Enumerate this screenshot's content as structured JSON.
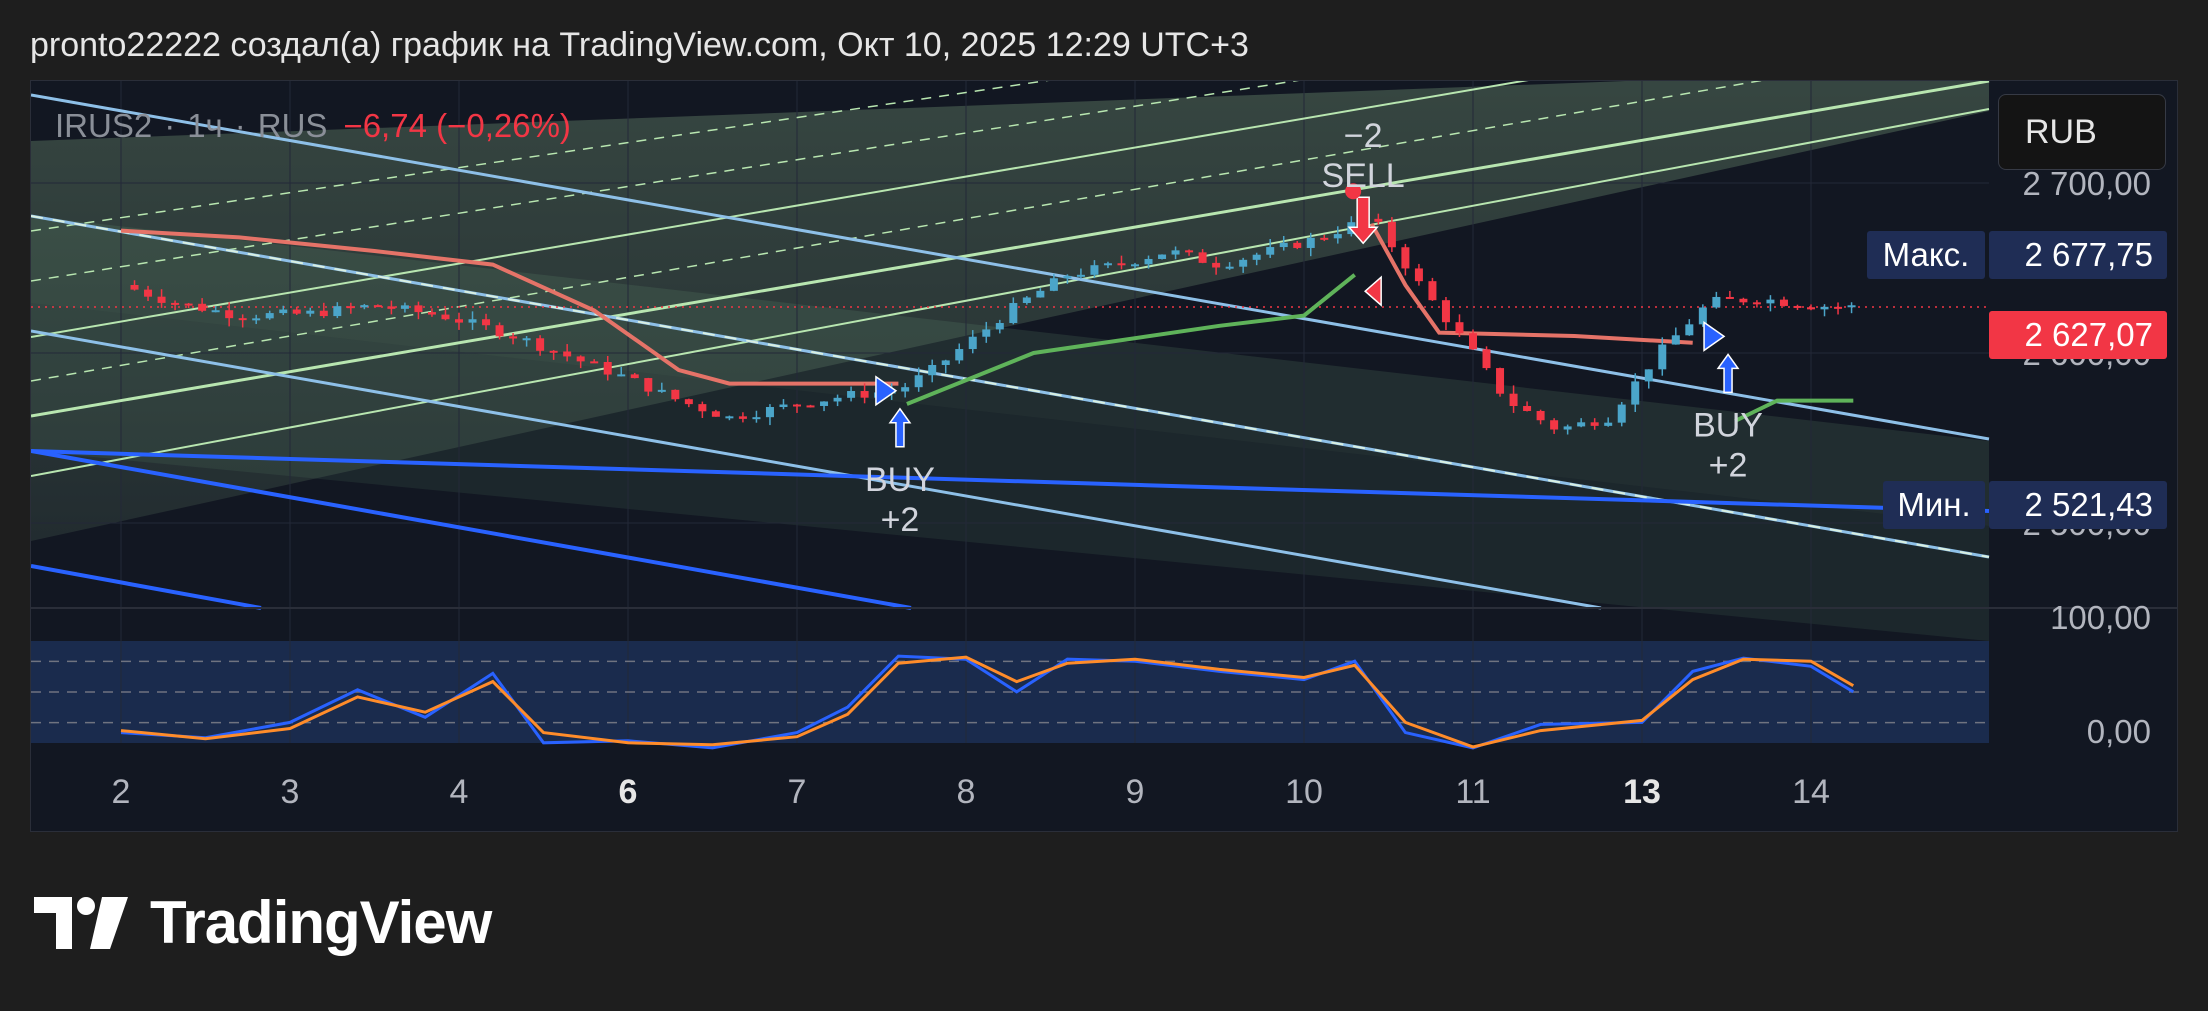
{
  "header": {
    "title": "pronto22222 создал(а) график на TradingView.com, Окт 10, 2025 12:29 UTC+3"
  },
  "chart": {
    "symbol": "IRUS2",
    "interval": "1ч",
    "exchange": "RUS",
    "change": "−6,74 (−0,26%)",
    "currency": "RUB",
    "max_label": "Макс.",
    "max_value": "2 677,75",
    "min_label": "Мин.",
    "min_value": "2 521,43",
    "last_price": "2 627,07"
  },
  "colors": {
    "background": "#121722",
    "bear": "#f23645",
    "bull": "#4ba5c9",
    "supertrend_bear": "#e57368",
    "supertrend_bull": "#5fb35a",
    "channel_line": "#8ec0e8",
    "trend_line": "#2962ff",
    "fib_green": "#b8e6b0",
    "stoch_k": "#2962ff",
    "stoch_d": "#ff8c2a",
    "max_tag": "#1f2d55",
    "last_tag": "#f23645"
  },
  "footer": {
    "brand": "TradingView"
  },
  "chart_data": {
    "type": "candlestick",
    "currency": "RUB",
    "ylim": [
      2450,
      2760
    ],
    "x_ticks": [
      {
        "label": "2",
        "bold": false
      },
      {
        "label": "3",
        "bold": false
      },
      {
        "label": "4",
        "bold": false
      },
      {
        "label": "6",
        "bold": true
      },
      {
        "label": "7",
        "bold": false
      },
      {
        "label": "8",
        "bold": false
      },
      {
        "label": "9",
        "bold": false
      },
      {
        "label": "10",
        "bold": false
      },
      {
        "label": "11",
        "bold": false
      },
      {
        "label": "13",
        "bold": true
      },
      {
        "label": "14",
        "bold": false
      }
    ],
    "y_ticks": [
      "2 700,00",
      "2 600,00",
      "2 500,00"
    ],
    "close_series": [
      {
        "t": 0.0,
        "v": 2640
      },
      {
        "t": 0.3,
        "v": 2630
      },
      {
        "t": 0.7,
        "v": 2622
      },
      {
        "t": 1.1,
        "v": 2623
      },
      {
        "t": 1.5,
        "v": 2628
      },
      {
        "t": 1.9,
        "v": 2622
      },
      {
        "t": 2.3,
        "v": 2611
      },
      {
        "t": 2.7,
        "v": 2596
      },
      {
        "t": 3.0,
        "v": 2585
      },
      {
        "t": 3.3,
        "v": 2572
      },
      {
        "t": 3.6,
        "v": 2562
      },
      {
        "t": 4.0,
        "v": 2570
      },
      {
        "t": 4.3,
        "v": 2575
      },
      {
        "t": 4.6,
        "v": 2578
      },
      {
        "t": 4.8,
        "v": 2590
      },
      {
        "t": 5.0,
        "v": 2605
      },
      {
        "t": 5.3,
        "v": 2628
      },
      {
        "t": 5.6,
        "v": 2646
      },
      {
        "t": 5.9,
        "v": 2652
      },
      {
        "t": 6.2,
        "v": 2660
      },
      {
        "t": 6.5,
        "v": 2652
      },
      {
        "t": 6.8,
        "v": 2660
      },
      {
        "t": 7.1,
        "v": 2668
      },
      {
        "t": 7.4,
        "v": 2680
      },
      {
        "t": 7.7,
        "v": 2638
      },
      {
        "t": 8.0,
        "v": 2600
      },
      {
        "t": 8.2,
        "v": 2572
      },
      {
        "t": 8.5,
        "v": 2555
      },
      {
        "t": 8.8,
        "v": 2562
      },
      {
        "t": 9.1,
        "v": 2600
      },
      {
        "t": 9.4,
        "v": 2630
      },
      {
        "t": 9.7,
        "v": 2632
      },
      {
        "t": 10.0,
        "v": 2628
      },
      {
        "t": 10.25,
        "v": 2627
      }
    ],
    "markers": [
      {
        "type": "BUY",
        "qty": "+2",
        "line1": "BUY",
        "line2": "+2",
        "t": 4.55,
        "price": 2566
      },
      {
        "type": "SELL",
        "qty": "−2",
        "line1": "−2",
        "line2": "SELL",
        "t": 7.35,
        "price": 2674
      },
      {
        "type": "BUY",
        "qty": "+2",
        "line1": "BUY",
        "line2": "+2",
        "t": 9.45,
        "price": 2598
      }
    ],
    "stochastic": {
      "ylim": [
        0,
        100
      ],
      "y_ticks": [
        "100,00",
        "0,00"
      ],
      "bands": [
        80,
        50,
        20
      ],
      "k": [
        {
          "t": 0.0,
          "v": 20
        },
        {
          "t": 0.5,
          "v": 15
        },
        {
          "t": 1.0,
          "v": 30
        },
        {
          "t": 1.4,
          "v": 62
        },
        {
          "t": 1.8,
          "v": 35
        },
        {
          "t": 2.2,
          "v": 78
        },
        {
          "t": 2.5,
          "v": 10
        },
        {
          "t": 3.0,
          "v": 12
        },
        {
          "t": 3.5,
          "v": 5
        },
        {
          "t": 4.0,
          "v": 20
        },
        {
          "t": 4.3,
          "v": 45
        },
        {
          "t": 4.6,
          "v": 95
        },
        {
          "t": 5.0,
          "v": 92
        },
        {
          "t": 5.3,
          "v": 60
        },
        {
          "t": 5.6,
          "v": 92
        },
        {
          "t": 6.0,
          "v": 90
        },
        {
          "t": 6.5,
          "v": 80
        },
        {
          "t": 7.0,
          "v": 72
        },
        {
          "t": 7.3,
          "v": 90
        },
        {
          "t": 7.6,
          "v": 20
        },
        {
          "t": 8.0,
          "v": 5
        },
        {
          "t": 8.4,
          "v": 28
        },
        {
          "t": 9.0,
          "v": 30
        },
        {
          "t": 9.3,
          "v": 80
        },
        {
          "t": 9.6,
          "v": 93
        },
        {
          "t": 10.0,
          "v": 85
        },
        {
          "t": 10.25,
          "v": 60
        }
      ],
      "d": [
        {
          "t": 0.0,
          "v": 22
        },
        {
          "t": 0.5,
          "v": 14
        },
        {
          "t": 1.0,
          "v": 24
        },
        {
          "t": 1.4,
          "v": 55
        },
        {
          "t": 1.8,
          "v": 40
        },
        {
          "t": 2.2,
          "v": 70
        },
        {
          "t": 2.5,
          "v": 20
        },
        {
          "t": 3.0,
          "v": 10
        },
        {
          "t": 3.5,
          "v": 8
        },
        {
          "t": 4.0,
          "v": 16
        },
        {
          "t": 4.3,
          "v": 38
        },
        {
          "t": 4.6,
          "v": 88
        },
        {
          "t": 5.0,
          "v": 94
        },
        {
          "t": 5.3,
          "v": 70
        },
        {
          "t": 5.6,
          "v": 88
        },
        {
          "t": 6.0,
          "v": 92
        },
        {
          "t": 6.5,
          "v": 82
        },
        {
          "t": 7.0,
          "v": 74
        },
        {
          "t": 7.3,
          "v": 86
        },
        {
          "t": 7.6,
          "v": 30
        },
        {
          "t": 8.0,
          "v": 6
        },
        {
          "t": 8.4,
          "v": 22
        },
        {
          "t": 9.0,
          "v": 32
        },
        {
          "t": 9.3,
          "v": 72
        },
        {
          "t": 9.6,
          "v": 92
        },
        {
          "t": 10.0,
          "v": 90
        },
        {
          "t": 10.25,
          "v": 66
        }
      ]
    }
  }
}
